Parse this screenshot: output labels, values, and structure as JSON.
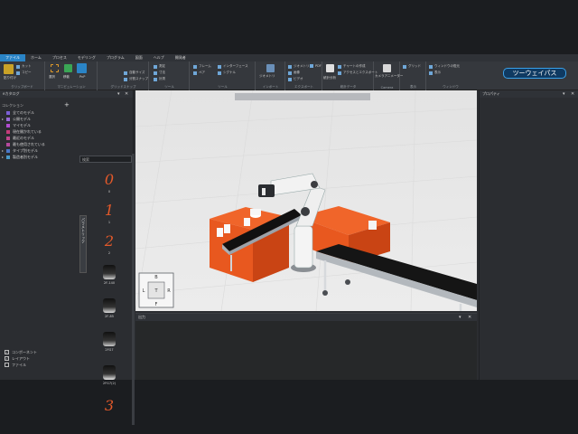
{
  "menu": [
    "ファイル",
    "ホーム",
    "プロセス",
    "モデリング",
    "プログラム",
    "図面",
    "ヘルプ",
    "開発者"
  ],
  "ribbon_groups": [
    {
      "label": "クリップボード",
      "buttons": [
        "貼り付け",
        "カット",
        "コピー"
      ]
    },
    {
      "label": "マニピュレーション",
      "buttons": [
        "選択",
        "移動",
        "PnP",
        "インタラクティブ"
      ]
    },
    {
      "label": "グリッドスナップ",
      "buttons": [
        "自動サイズ",
        "分割スナップ"
      ]
    },
    {
      "label": "ツール",
      "buttons": [
        "測定",
        "寸法",
        "計測"
      ]
    },
    {
      "label": "ツール",
      "buttons": [
        "フレーム",
        "インターフェース",
        "ペア",
        "シグナル"
      ]
    },
    {
      "label": "インポート",
      "buttons": [
        "ジオメトリ",
        "レイアウト"
      ]
    },
    {
      "label": "エクスポート",
      "buttons": [
        "ジオメトリ",
        "画像",
        "PDF",
        "ビデオ"
      ]
    },
    {
      "label": "統計データ",
      "buttons": [
        "統計分析",
        "チャートの作成",
        "アクセスとエクスポート"
      ]
    },
    {
      "label": "Camera",
      "buttons": [
        "カメラアニメーター"
      ]
    },
    {
      "label": "表示",
      "buttons": [
        "グリッド",
        "ワイヤフレーム"
      ]
    },
    {
      "label": "ウィンドウ",
      "buttons": [
        "ウィンドウの復元",
        "表示"
      ]
    }
  ],
  "share_button": "ツーウェイパス",
  "catalog": {
    "title": "eカタログ",
    "collection_header": "コレクション",
    "tree": [
      {
        "label": "全てのモデル",
        "color": "#7b5fd6"
      },
      {
        "label": "公開モデル",
        "color": "#9a6ad8"
      },
      {
        "label": "マイモデル",
        "color": "#b14bd0"
      },
      {
        "label": "現在開かれている",
        "color": "#c43b7a"
      },
      {
        "label": "最近のモデル",
        "color": "#c0478e"
      },
      {
        "label": "最も使用されている",
        "color": "#b54a9e"
      },
      {
        "label": "タイプ別モデル",
        "color": "#4a78c8"
      },
      {
        "label": "製造者別モデル",
        "color": "#4a9ac8"
      }
    ],
    "search_placeholder": "検索",
    "side_tab": "パラメトリック",
    "items": [
      {
        "glyph": "0",
        "label": "0"
      },
      {
        "glyph": "1",
        "label": "1"
      },
      {
        "glyph": "2",
        "label": "2"
      },
      {
        "glyph": "",
        "label": "2F-140"
      },
      {
        "glyph": "",
        "label": "2F-85"
      },
      {
        "glyph": "",
        "label": "2FG7"
      },
      {
        "glyph": "",
        "label": "2FG7(2)"
      },
      {
        "glyph": "3",
        "label": ""
      }
    ],
    "filters": [
      {
        "label": "コンポーネント",
        "checked": true
      },
      {
        "label": "レイアウト",
        "checked": true
      },
      {
        "label": "ファイル",
        "checked": false
      }
    ]
  },
  "properties": {
    "title": "プロパティ"
  },
  "output": {
    "title": "出力"
  },
  "nav_cube": {
    "top": "B",
    "left": "L",
    "center": "T",
    "right": "R",
    "bottom": "F"
  }
}
